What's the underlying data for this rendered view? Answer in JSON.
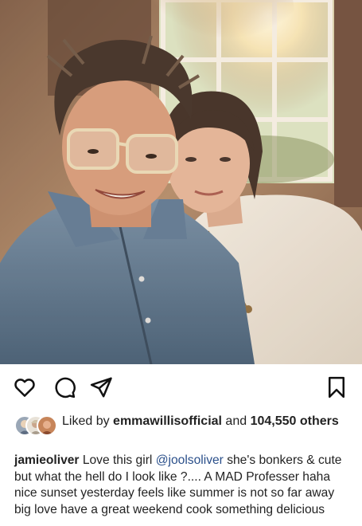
{
  "post": {
    "photo": {
      "subject": "selfie-photo"
    },
    "actions": {
      "like_icon": "heart-icon",
      "comment_icon": "comment-icon",
      "share_icon": "send-icon",
      "save_icon": "bookmark-icon"
    },
    "likes": {
      "prefix": "Liked by ",
      "liker": "emmawillisofficial",
      "middle": " and ",
      "count": "104,550",
      "suffix": " others"
    },
    "caption": {
      "username": "jamieoliver",
      "text_before": " Love this girl ",
      "mention": "@joolsoliver",
      "text_after": " she's bonkers & cute but what the hell do I look like ?.... A MAD Professer haha nice sunset yesterday feels like summer is not so far away big love have a great weekend cook something delicious"
    }
  },
  "colors": {
    "text": "#222222",
    "mention": "#2a4f8a",
    "background": "#ffffff"
  }
}
